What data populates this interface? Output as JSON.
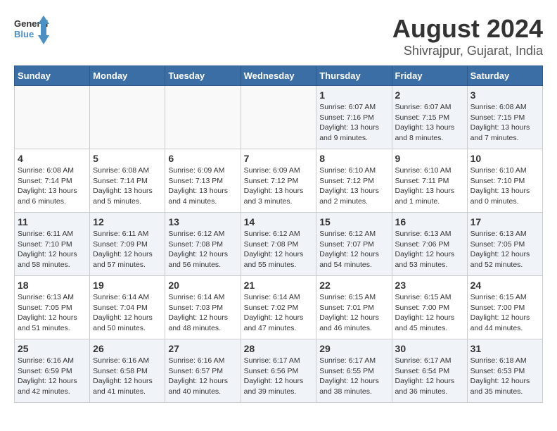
{
  "logo": {
    "line1": "General",
    "line2": "Blue"
  },
  "title": "August 2024",
  "subtitle": "Shivrajpur, Gujarat, India",
  "days_of_week": [
    "Sunday",
    "Monday",
    "Tuesday",
    "Wednesday",
    "Thursday",
    "Friday",
    "Saturday"
  ],
  "weeks": [
    [
      {
        "day": "",
        "info": ""
      },
      {
        "day": "",
        "info": ""
      },
      {
        "day": "",
        "info": ""
      },
      {
        "day": "",
        "info": ""
      },
      {
        "day": "1",
        "info": "Sunrise: 6:07 AM\nSunset: 7:16 PM\nDaylight: 13 hours\nand 9 minutes."
      },
      {
        "day": "2",
        "info": "Sunrise: 6:07 AM\nSunset: 7:15 PM\nDaylight: 13 hours\nand 8 minutes."
      },
      {
        "day": "3",
        "info": "Sunrise: 6:08 AM\nSunset: 7:15 PM\nDaylight: 13 hours\nand 7 minutes."
      }
    ],
    [
      {
        "day": "4",
        "info": "Sunrise: 6:08 AM\nSunset: 7:14 PM\nDaylight: 13 hours\nand 6 minutes."
      },
      {
        "day": "5",
        "info": "Sunrise: 6:08 AM\nSunset: 7:14 PM\nDaylight: 13 hours\nand 5 minutes."
      },
      {
        "day": "6",
        "info": "Sunrise: 6:09 AM\nSunset: 7:13 PM\nDaylight: 13 hours\nand 4 minutes."
      },
      {
        "day": "7",
        "info": "Sunrise: 6:09 AM\nSunset: 7:12 PM\nDaylight: 13 hours\nand 3 minutes."
      },
      {
        "day": "8",
        "info": "Sunrise: 6:10 AM\nSunset: 7:12 PM\nDaylight: 13 hours\nand 2 minutes."
      },
      {
        "day": "9",
        "info": "Sunrise: 6:10 AM\nSunset: 7:11 PM\nDaylight: 13 hours\nand 1 minute."
      },
      {
        "day": "10",
        "info": "Sunrise: 6:10 AM\nSunset: 7:10 PM\nDaylight: 13 hours\nand 0 minutes."
      }
    ],
    [
      {
        "day": "11",
        "info": "Sunrise: 6:11 AM\nSunset: 7:10 PM\nDaylight: 12 hours\nand 58 minutes."
      },
      {
        "day": "12",
        "info": "Sunrise: 6:11 AM\nSunset: 7:09 PM\nDaylight: 12 hours\nand 57 minutes."
      },
      {
        "day": "13",
        "info": "Sunrise: 6:12 AM\nSunset: 7:08 PM\nDaylight: 12 hours\nand 56 minutes."
      },
      {
        "day": "14",
        "info": "Sunrise: 6:12 AM\nSunset: 7:08 PM\nDaylight: 12 hours\nand 55 minutes."
      },
      {
        "day": "15",
        "info": "Sunrise: 6:12 AM\nSunset: 7:07 PM\nDaylight: 12 hours\nand 54 minutes."
      },
      {
        "day": "16",
        "info": "Sunrise: 6:13 AM\nSunset: 7:06 PM\nDaylight: 12 hours\nand 53 minutes."
      },
      {
        "day": "17",
        "info": "Sunrise: 6:13 AM\nSunset: 7:05 PM\nDaylight: 12 hours\nand 52 minutes."
      }
    ],
    [
      {
        "day": "18",
        "info": "Sunrise: 6:13 AM\nSunset: 7:05 PM\nDaylight: 12 hours\nand 51 minutes."
      },
      {
        "day": "19",
        "info": "Sunrise: 6:14 AM\nSunset: 7:04 PM\nDaylight: 12 hours\nand 50 minutes."
      },
      {
        "day": "20",
        "info": "Sunrise: 6:14 AM\nSunset: 7:03 PM\nDaylight: 12 hours\nand 48 minutes."
      },
      {
        "day": "21",
        "info": "Sunrise: 6:14 AM\nSunset: 7:02 PM\nDaylight: 12 hours\nand 47 minutes."
      },
      {
        "day": "22",
        "info": "Sunrise: 6:15 AM\nSunset: 7:01 PM\nDaylight: 12 hours\nand 46 minutes."
      },
      {
        "day": "23",
        "info": "Sunrise: 6:15 AM\nSunset: 7:00 PM\nDaylight: 12 hours\nand 45 minutes."
      },
      {
        "day": "24",
        "info": "Sunrise: 6:15 AM\nSunset: 7:00 PM\nDaylight: 12 hours\nand 44 minutes."
      }
    ],
    [
      {
        "day": "25",
        "info": "Sunrise: 6:16 AM\nSunset: 6:59 PM\nDaylight: 12 hours\nand 42 minutes."
      },
      {
        "day": "26",
        "info": "Sunrise: 6:16 AM\nSunset: 6:58 PM\nDaylight: 12 hours\nand 41 minutes."
      },
      {
        "day": "27",
        "info": "Sunrise: 6:16 AM\nSunset: 6:57 PM\nDaylight: 12 hours\nand 40 minutes."
      },
      {
        "day": "28",
        "info": "Sunrise: 6:17 AM\nSunset: 6:56 PM\nDaylight: 12 hours\nand 39 minutes."
      },
      {
        "day": "29",
        "info": "Sunrise: 6:17 AM\nSunset: 6:55 PM\nDaylight: 12 hours\nand 38 minutes."
      },
      {
        "day": "30",
        "info": "Sunrise: 6:17 AM\nSunset: 6:54 PM\nDaylight: 12 hours\nand 36 minutes."
      },
      {
        "day": "31",
        "info": "Sunrise: 6:18 AM\nSunset: 6:53 PM\nDaylight: 12 hours\nand 35 minutes."
      }
    ]
  ]
}
